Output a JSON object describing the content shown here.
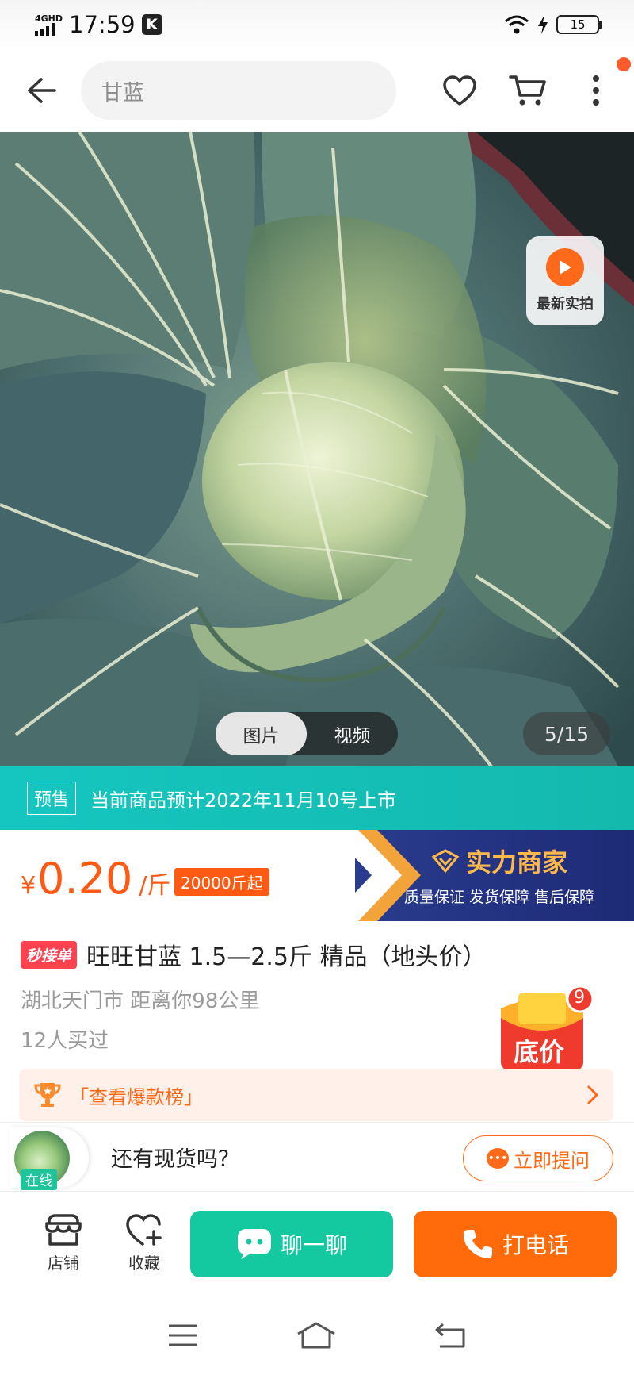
{
  "status_bar": {
    "network": "4GHD",
    "time": "17:59",
    "app_badge": "K",
    "battery": "15"
  },
  "search": {
    "query": "甘蓝"
  },
  "gallery": {
    "live_label": "最新实拍",
    "tabs": [
      "图片",
      "视频"
    ],
    "active_tab": "图片",
    "counter": "5/15"
  },
  "presale": {
    "tag": "预售",
    "text": "当前商品预计2022年11月10号上市"
  },
  "price": {
    "symbol": "¥",
    "value": "0.20",
    "unit": "/斤",
    "min_order": "20000斤起"
  },
  "merchant": {
    "title": "实力商家",
    "guarantees": "质量保证 发货保障 售后保障"
  },
  "product": {
    "badge": "秒接单",
    "title": "旺旺甘蓝 1.5—2.5斤 精品（地头价）",
    "location": "湖北天门市 距离你98公里",
    "sold": "12人买过",
    "low_price_label": "底价",
    "low_price_count": "9",
    "hot_list": "「查看爆款榜」"
  },
  "qa": {
    "online": "在线",
    "question": "还有现货吗？",
    "ask_button": "立即提问"
  },
  "actions": {
    "shop": "店铺",
    "favorite": "收藏",
    "chat": "聊一聊",
    "call": "打电话"
  },
  "colors": {
    "accent_orange": "#ff6a0a",
    "teal": "#14c8a0",
    "presale_teal": "#15c6c0",
    "merchant_blue": "#1d2a76"
  }
}
